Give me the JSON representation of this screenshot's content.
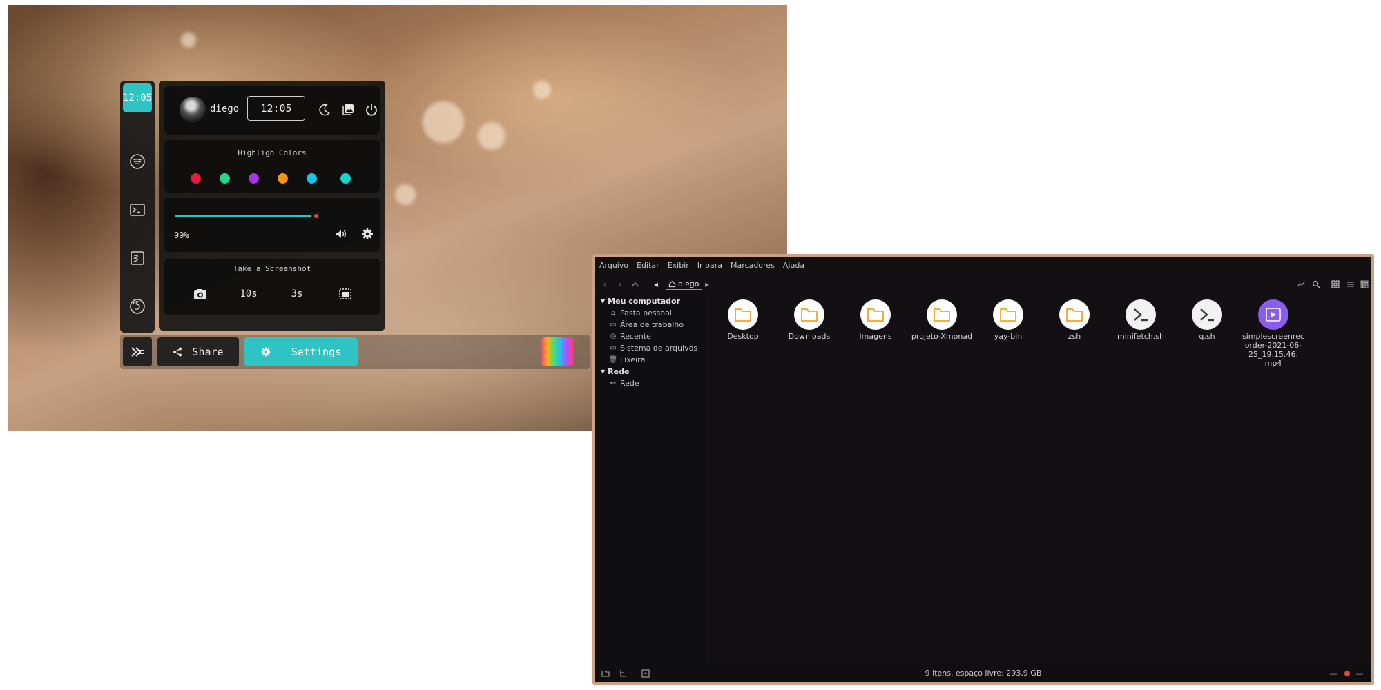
{
  "dock": {
    "clock": "12:05",
    "icons": [
      "spotify-icon",
      "terminal-icon",
      "notes-icon",
      "firefox-icon"
    ]
  },
  "control_center": {
    "user": {
      "name": "diego",
      "time": "12:05",
      "icons": [
        "moon-icon",
        "image-icon",
        "power-icon"
      ]
    },
    "highlight": {
      "title": "Highligh Colors",
      "colors": [
        "#e8193c",
        "#22d98a",
        "#a637e8",
        "#f4931e",
        "#19c3e8",
        "#16d6c9"
      ]
    },
    "volume": {
      "level": 0.99,
      "percent_label": "99%",
      "icons": [
        "speaker-icon",
        "gear-icon"
      ]
    },
    "screenshot": {
      "title": "Take a Screenshot",
      "timer_10": "10s",
      "timer_3": "3s"
    }
  },
  "bottom_bar": {
    "share_label": "Share",
    "settings_label": "Settings",
    "accent": "#2ec4c4"
  },
  "file_manager": {
    "menu": [
      "Arquivo",
      "Editar",
      "Exibir",
      "Ir para",
      "Marcadores",
      "Ajuda"
    ],
    "breadcrumb": "diego",
    "sidebar": {
      "computer_header": "Meu computador",
      "computer_items": [
        "Pasta pessoal",
        "Área de trabalho",
        "Recente",
        "Sistema de arquivos",
        "Lixeira"
      ],
      "network_header": "Rede",
      "network_items": [
        "Rede"
      ]
    },
    "files": [
      {
        "name": "Desktop",
        "icon": "folder-icon"
      },
      {
        "name": "Downloads",
        "icon": "folder-icon"
      },
      {
        "name": "Imagens",
        "icon": "folder-icon"
      },
      {
        "name": "projeto-Xmonad",
        "icon": "folder-icon"
      },
      {
        "name": "yay-bin",
        "icon": "folder-icon"
      },
      {
        "name": "zsh",
        "icon": "folder-icon"
      },
      {
        "name": "minifetch.sh",
        "icon": "script-icon"
      },
      {
        "name": "q.sh",
        "icon": "script-icon"
      },
      {
        "name": "simplescreenrec order-2021-06-25_19.15.46. mp4",
        "icon": "video-icon"
      }
    ],
    "status": "9 itens, espaço livre: 293,9 GB"
  }
}
